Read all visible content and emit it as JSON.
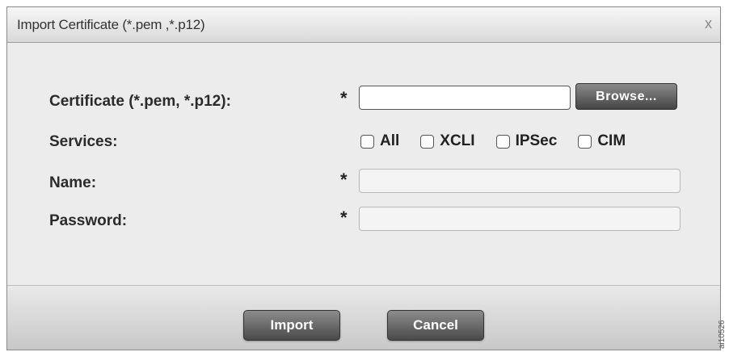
{
  "dialog": {
    "title": "Import Certificate (*.pem ,*.p12)",
    "close_label": "x"
  },
  "form": {
    "certificate_label": "Certificate (*.pem, *.p12):",
    "certificate_value": "",
    "browse_label": "Browse...",
    "services_label": "Services:",
    "services": [
      {
        "label": "All",
        "checked": false
      },
      {
        "label": "XCLI",
        "checked": false
      },
      {
        "label": "IPSec",
        "checked": false
      },
      {
        "label": "CIM",
        "checked": false
      }
    ],
    "name_label": "Name:",
    "name_value": "",
    "password_label": "Password:",
    "password_value": "",
    "required_mark": "*"
  },
  "footer": {
    "import_label": "Import",
    "cancel_label": "Cancel"
  },
  "figure_code": "ai10526"
}
